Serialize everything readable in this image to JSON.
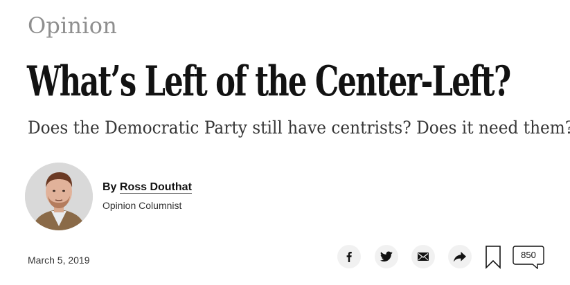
{
  "article": {
    "section": "Opinion",
    "headline": "What’s Left of the Center-Left?",
    "summary": "Does the Democratic Party still have centrists? Does it need them?",
    "byline_prefix": "By ",
    "author": "Ross Douthat",
    "author_role": "Opinion Columnist",
    "date": "March 5, 2019"
  },
  "share": {
    "buttons": [
      "facebook-icon",
      "twitter-icon",
      "email-icon",
      "share-forward-icon"
    ],
    "bookmark_icon": "bookmark-icon",
    "comment_count": "850"
  },
  "colors": {
    "section": "#8f8f8f",
    "headline": "#121212",
    "button_bg": "#f1f1f1"
  }
}
